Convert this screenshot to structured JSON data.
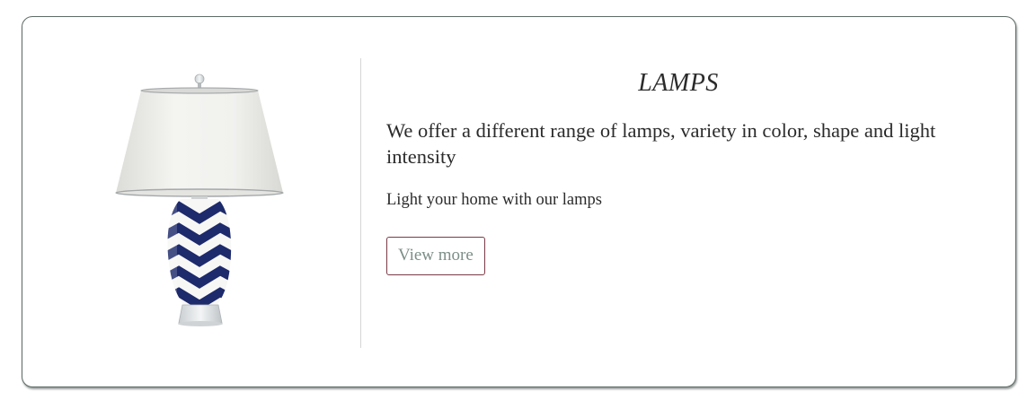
{
  "card": {
    "title": "LAMPS",
    "description": "We offer a different range of lamps, variety in color, shape and light intensity",
    "tagline": "Light your home with our lamps",
    "button_label": "View more",
    "image_icon": "table-lamp-chevron-icon"
  },
  "colors": {
    "card_border": "#5d6b66",
    "button_border": "#7a3b47",
    "button_text": "#7d8e89",
    "lamp_base_blue": "#1d2a6b",
    "lamp_shade": "#efefec"
  }
}
